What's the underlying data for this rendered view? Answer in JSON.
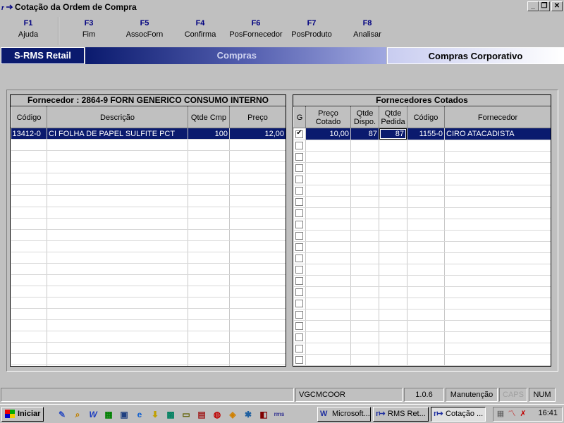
{
  "window": {
    "title": "Cotação da Ordem de Compra"
  },
  "fkeys": [
    {
      "key": "F1",
      "label": "Ajuda"
    },
    {
      "key": "F3",
      "label": "Fim"
    },
    {
      "key": "F5",
      "label": "AssocForn"
    },
    {
      "key": "F4",
      "label": "Confirma"
    },
    {
      "key": "F6",
      "label": "PosFornecedor"
    },
    {
      "key": "F7",
      "label": "PosProduto"
    },
    {
      "key": "F8",
      "label": "Analisar"
    }
  ],
  "banner": {
    "left": "S-RMS Retail",
    "middle": "Compras",
    "right": "Compras Corporativo"
  },
  "left_grid": {
    "caption": "Fornecedor :   2864-9  FORN GENERICO CONSUMO INTERNO",
    "headers": {
      "codigo": "Código",
      "descricao": "Descrição",
      "qtde": "Qtde Cmp",
      "preco": "Preço"
    },
    "row": {
      "codigo": "13412-0",
      "descricao": "CI FOLHA DE PAPEL SULFITE PCT",
      "qtde": "100",
      "preco": "12,00"
    }
  },
  "right_grid": {
    "caption": "Fornecedores Cotados",
    "headers": {
      "g": "G",
      "preco": "Preço Cotado",
      "disp": "Qtde Dispo.",
      "pedida": "Qtde Pedida",
      "codigo": "Código",
      "fornecedor": "Fornecedor"
    },
    "row": {
      "preco": "10,00",
      "disp": "87",
      "pedida": "87",
      "codigo": "1155-0",
      "fornecedor": "CIRO ATACADISTA"
    }
  },
  "status": {
    "user": "VGCMCOOR",
    "version": "1.0.6",
    "mode": "Manutenção",
    "caps": "CAPS",
    "num": "NUM"
  },
  "taskbar": {
    "start": "Iniciar",
    "tasks": [
      "Microsoft...",
      "RMS Ret...",
      "Cotação ..."
    ],
    "clock": "16:41"
  },
  "colors": {
    "selection": "#0a1a6e",
    "banner_dark": "#0a1a6e"
  }
}
